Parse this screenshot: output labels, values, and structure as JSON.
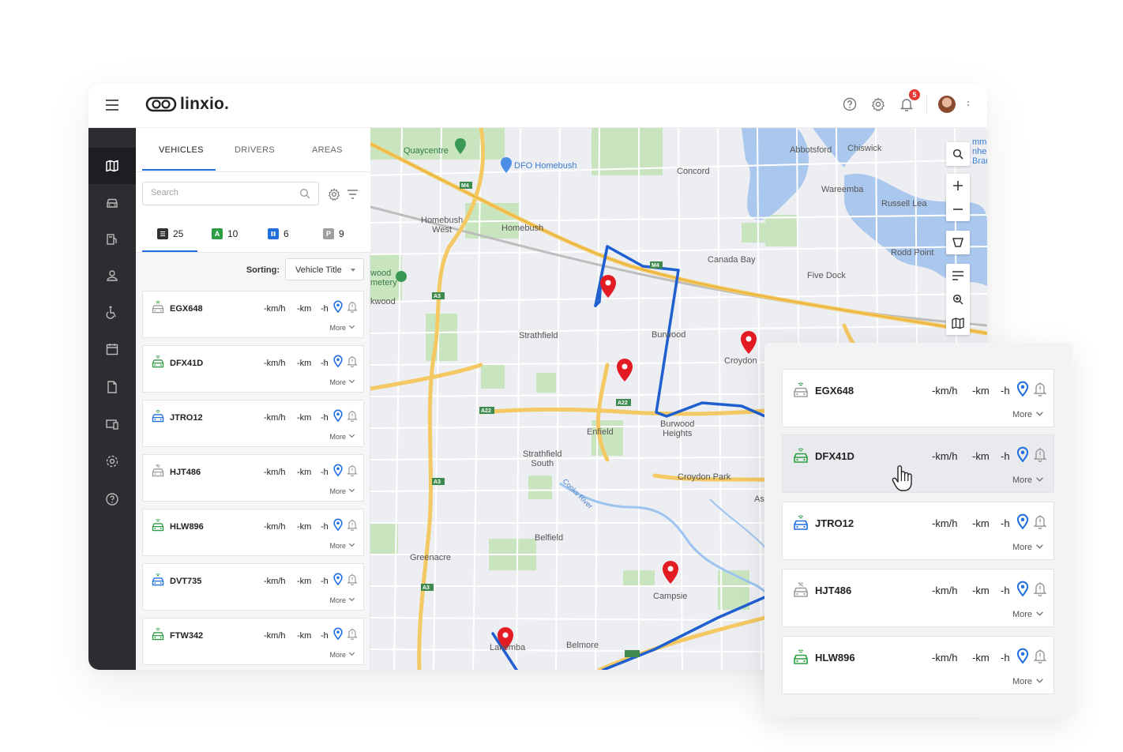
{
  "app": {
    "brand": "linxio.",
    "notification_count": "5"
  },
  "panel": {
    "tabs": [
      "VEHICLES",
      "DRIVERS",
      "AREAS"
    ],
    "search_placeholder": "Search",
    "counts": [
      {
        "icon": "list-icon",
        "value": "25",
        "color": "#222222"
      },
      {
        "icon": "driving-icon",
        "value": "10",
        "color": "#2e9e44"
      },
      {
        "icon": "pause-icon",
        "value": "6",
        "color": "#1f6fe0"
      },
      {
        "icon": "parked-icon",
        "value": "9",
        "color": "#9e9e9e"
      }
    ],
    "count_letters": {
      "driving": "A",
      "parked": "P"
    },
    "sorting_label": "Sorting:",
    "sorting_value": "Vehicle Title"
  },
  "vehicles": [
    {
      "plate": "EGX648",
      "speed": "-km/h",
      "distance": "-km",
      "hours": "-h",
      "more": "More",
      "status": "grey"
    },
    {
      "plate": "DFX41D",
      "speed": "-km/h",
      "distance": "-km",
      "hours": "-h",
      "more": "More",
      "status": "green"
    },
    {
      "plate": "JTRO12",
      "speed": "-km/h",
      "distance": "-km",
      "hours": "-h",
      "more": "More",
      "status": "blue"
    },
    {
      "plate": "HJT486",
      "speed": "-km/h",
      "distance": "-km",
      "hours": "-h",
      "more": "More",
      "status": "grey-nosignal"
    },
    {
      "plate": "HLW896",
      "speed": "-km/h",
      "distance": "-km",
      "hours": "-h",
      "more": "More",
      "status": "green"
    },
    {
      "plate": "DVT735",
      "speed": "-km/h",
      "distance": "-km",
      "hours": "-h",
      "more": "More",
      "status": "blue"
    },
    {
      "plate": "FTW342",
      "speed": "-km/h",
      "distance": "-km",
      "hours": "-h",
      "more": "More",
      "status": "green"
    }
  ],
  "map_labels": {
    "quaycentre": "Quaycentre",
    "dfo": "DFO Homebush",
    "concord": "Concord",
    "abbotsford": "Abbotsford",
    "chiswick": "Chiswick",
    "wareemba": "Wareemba",
    "russell_lea": "Russell Lea",
    "rodd_point": "Rodd Point",
    "five_dock": "Five Dock",
    "canada_bay": "Canada Bay",
    "homebush_west": "Homebush\nWest",
    "homebush": "Homebush",
    "wood_cemetery": "wood\nmetery",
    "kwood": "kwood",
    "strathfield": "Strathfield",
    "burwood": "Burwood",
    "croydon": "Croydon",
    "enfield": "Enfield",
    "burwood_heights": "Burwood\nHeights",
    "strathfield_south": "Strathfield\nSouth",
    "croydon_park": "Croydon Park",
    "ash": "Ash",
    "belfield": "Belfield",
    "greenacre": "Greenacre",
    "campsie": "Campsie",
    "lakemba": "Lakemba",
    "belmore": "Belmore",
    "cooks_river": "Cooks River",
    "edge_right": "mmo\nnhea\nBran",
    "m4": "M4",
    "a3": "A3",
    "a22": "A22"
  },
  "floating": [
    {
      "plate": "EGX648",
      "speed": "-km/h",
      "distance": "-km",
      "hours": "-h",
      "more": "More",
      "status": "grey"
    },
    {
      "plate": "DFX41D",
      "speed": "-km/h",
      "distance": "-km",
      "hours": "-h",
      "more": "More",
      "status": "green"
    },
    {
      "plate": "JTRO12",
      "speed": "-km/h",
      "distance": "-km",
      "hours": "-h",
      "more": "More",
      "status": "blue"
    },
    {
      "plate": "HJT486",
      "speed": "-km/h",
      "distance": "-km",
      "hours": "-h",
      "more": "More",
      "status": "grey-nosignal"
    },
    {
      "plate": "HLW896",
      "speed": "-km/h",
      "distance": "-km",
      "hours": "-h",
      "more": "More",
      "status": "green"
    }
  ],
  "colors": {
    "accent": "#1f6fe0",
    "sidebar": "#2b2d30",
    "route": "#1f5fd0",
    "pin": "#e31b23"
  }
}
